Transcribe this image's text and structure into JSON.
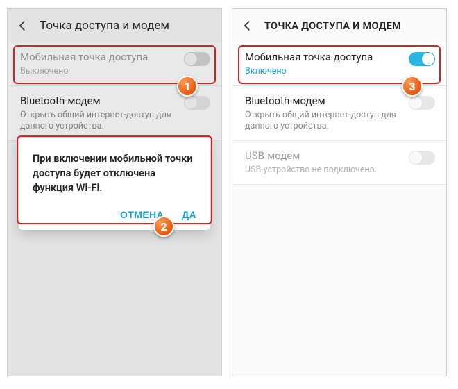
{
  "colors": {
    "highlight": "#d22424",
    "accent": "#1aa0cf",
    "badge": "#e85a12"
  },
  "left": {
    "appbar": {
      "title": "Точка доступа и модем"
    },
    "rows": {
      "hotspot": {
        "title": "Мобильная точка доступа",
        "sub": "Выключено",
        "toggle_on": false
      },
      "bt": {
        "title": "Bluetooth-модем",
        "sub": "Открыть общий интернет-доступ для данного устройства.",
        "toggle_on": false
      }
    },
    "dialog": {
      "message": "При включении мобильной точки доступа будет отключена функция Wi-Fi.",
      "cancel": "ОТМЕНА",
      "ok": "ДА"
    },
    "badges": {
      "one": "1",
      "two": "2"
    }
  },
  "right": {
    "appbar": {
      "title": "ТОЧКА ДОСТУПА И МОДЕМ"
    },
    "rows": {
      "hotspot": {
        "title": "Мобильная точка доступа",
        "sub": "Включено",
        "toggle_on": true
      },
      "bt": {
        "title": "Bluetooth-модем",
        "sub": "Открыть общий интернет-доступ для данного устройства.",
        "toggle_on": false
      },
      "usb": {
        "title": "USB-модем",
        "sub": "USB-устройство не подключено.",
        "toggle_on": false
      }
    },
    "badges": {
      "three": "3"
    }
  }
}
